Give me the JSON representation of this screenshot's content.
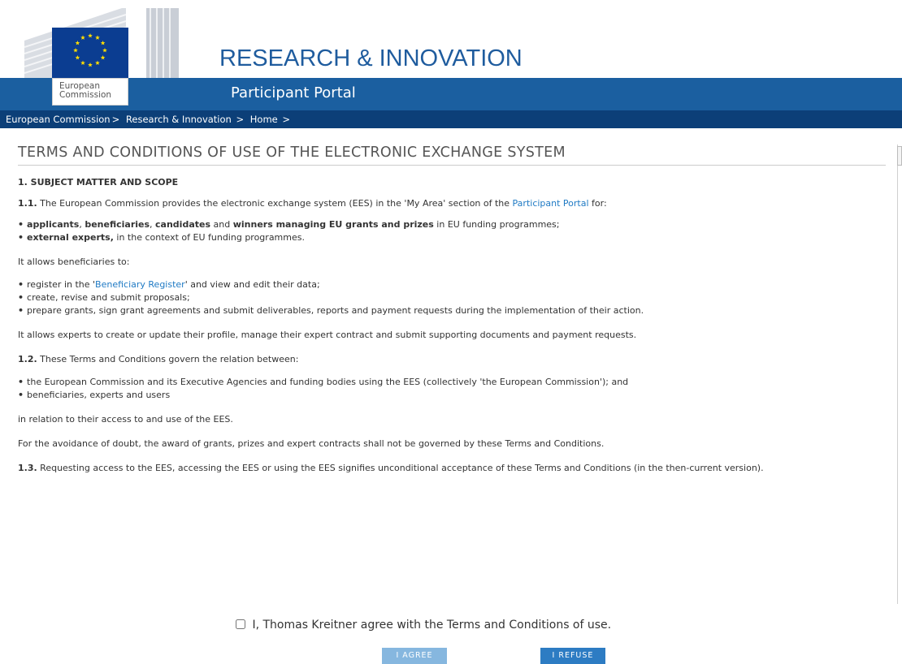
{
  "header": {
    "logo_line1": "European",
    "logo_line2": "Commission",
    "title": "RESEARCH & INNOVATION",
    "subtitle": "Participant Portal"
  },
  "breadcrumb": [
    "European Commission",
    "Research & Innovation",
    "Home"
  ],
  "page_title": "TERMS AND CONDITIONS OF USE OF THE ELECTRONIC EXCHANGE SYSTEM",
  "section1": {
    "heading": "1. SUBJECT MATTER AND SCOPE",
    "p1_1_num": "1.1.",
    "p1_1_text": "The European Commission provides the electronic exchange system (EES) in the 'My Area' section of the",
    "p1_1_link": "Participant Portal",
    "p1_1_tail": "for:",
    "list1": {
      "b1_a": "applicants",
      "b1_sep1": ", ",
      "b1_b": "beneficiaries",
      "b1_sep2": ", ",
      "b1_c": "candidates",
      "b1_and": " and ",
      "b1_d": "winners managing EU grants and prizes",
      "b1_tail": " in EU funding programmes;",
      "b2_a": "external experts,",
      "b2_tail": " in the context of EU funding programmes."
    },
    "allows_beneficiaries": "It allows beneficiaries to:",
    "list2": {
      "i1_pre": "register in the '",
      "i1_link": "Beneficiary Register",
      "i1_post": "' and view and edit their data;",
      "i2": "create, revise and submit proposals;",
      "i3": "prepare grants, sign grant agreements and submit deliverables, reports and payment requests during the implementation of their action."
    },
    "allows_experts": "It allows experts to create or update their profile, manage their expert contract and submit supporting documents and payment requests.",
    "p1_2_num": "1.2.",
    "p1_2_text": "These Terms and Conditions govern the relation between:",
    "list3": {
      "i1": "the European Commission and its Executive Agencies and funding bodies using the EES (collectively 'the European Commission'); and",
      "i2": "beneficiaries, experts and users"
    },
    "in_relation": "in relation to their access to and use of the EES.",
    "avoidance": "For the avoidance of doubt, the award of grants, prizes and expert contracts shall not be governed by these Terms and Conditions.",
    "p1_3_num": "1.3.",
    "p1_3_text": "Requesting access to the EES, accessing the EES or using the EES signifies unconditional acceptance of these Terms and Conditions (in the then-current version)."
  },
  "agreement": {
    "label": "I, Thomas Kreitner agree with the Terms and Conditions of use.",
    "checked": false,
    "agree_button": "I AGREE",
    "refuse_button": "I REFUSE"
  },
  "colors": {
    "brand_blue": "#1b5fa0",
    "breadcrumb_bg": "#0c3f78",
    "link": "#1f7ac4",
    "agree_btn_disabled": "#86b7df",
    "refuse_btn": "#2d7cc3"
  }
}
